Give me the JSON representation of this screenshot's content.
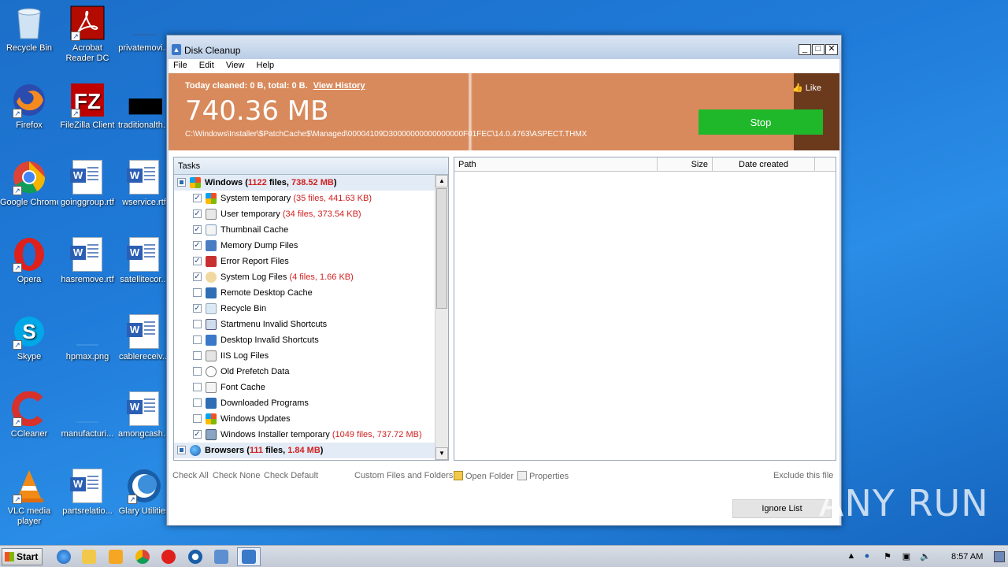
{
  "desktop": {
    "icons": [
      {
        "label": "Recycle Bin"
      },
      {
        "label": "Acrobat Reader DC"
      },
      {
        "label": "privatemovi..."
      },
      {
        "label": "Firefox"
      },
      {
        "label": "FileZilla Client"
      },
      {
        "label": "traditionalth..."
      },
      {
        "label": "Google Chrome"
      },
      {
        "label": "goinggroup.rtf"
      },
      {
        "label": "wservice.rtf"
      },
      {
        "label": "Opera"
      },
      {
        "label": "hasremove.rtf"
      },
      {
        "label": "satellitecor..."
      },
      {
        "label": "Skype"
      },
      {
        "label": "hpmax.png"
      },
      {
        "label": "cablereceiv..."
      },
      {
        "label": "CCleaner"
      },
      {
        "label": "manufacturi..."
      },
      {
        "label": "amongcash..."
      },
      {
        "label": "VLC media player"
      },
      {
        "label": "partsrelatio..."
      },
      {
        "label": "Glary Utilities"
      }
    ]
  },
  "window": {
    "title": "Disk Cleanup",
    "menu": [
      "File",
      "Edit",
      "View",
      "Help"
    ],
    "banner": {
      "summary": "Today cleaned: 0 B, total: 0 B.",
      "view_history": "View History",
      "size": "740.36 MB",
      "path": "C:\\Windows\\Installer\\$PatchCache$\\Managed\\00004109D30000000000000000F01FEC\\14.0.4763\\ASPECT.THMX",
      "like": "Like",
      "stop": "Stop",
      "colors": {
        "background": "#d88a5c",
        "stop": "#1fb82b",
        "dark": "#6b3a1d"
      }
    },
    "tasks": {
      "header": "Tasks",
      "groups": [
        {
          "name": "Windows",
          "open": "(",
          "count": "1122",
          "files": "files,",
          "size": "738.52 MB",
          "close": ")"
        }
      ],
      "items": [
        {
          "name": "System temporary",
          "checked": true,
          "detail_open": "(",
          "count": "35",
          "files": "files,",
          "size": "441.63 KB",
          "detail_close": ")"
        },
        {
          "name": "User temporary",
          "checked": true,
          "detail_open": "(",
          "count": "34",
          "files": "files,",
          "size": "373.54 KB",
          "detail_close": ")"
        },
        {
          "name": "Thumbnail Cache",
          "checked": true
        },
        {
          "name": "Memory Dump Files",
          "checked": true
        },
        {
          "name": "Error Report Files",
          "checked": true
        },
        {
          "name": "System Log Files",
          "checked": true,
          "detail_open": "(",
          "count": "4",
          "files": "files,",
          "size": "1.66 KB",
          "detail_close": ")"
        },
        {
          "name": "Remote Desktop Cache",
          "checked": false
        },
        {
          "name": "Recycle Bin",
          "checked": true
        },
        {
          "name": "Startmenu Invalid Shortcuts",
          "checked": false
        },
        {
          "name": "Desktop Invalid Shortcuts",
          "checked": false
        },
        {
          "name": "IIS Log Files",
          "checked": false
        },
        {
          "name": "Old Prefetch Data",
          "checked": false
        },
        {
          "name": "Font Cache",
          "checked": false
        },
        {
          "name": "Downloaded Programs",
          "checked": false
        },
        {
          "name": "Windows Updates",
          "checked": false
        },
        {
          "name": "Windows Installer temporary",
          "checked": true,
          "detail_open": "(",
          "count": "1049",
          "files": "files,",
          "size": "737.72 MB",
          "detail_close": ")"
        }
      ],
      "group2": {
        "name": "Browsers",
        "open": "(",
        "count": "111",
        "files": "files,",
        "size": "1.84 MB",
        "close": ")"
      }
    },
    "files": {
      "columns": [
        "Path",
        "Size",
        "Date created"
      ]
    },
    "bottom": {
      "check_all": "Check All",
      "check_none": "Check None",
      "check_default": "Check Default",
      "custom": "Custom Files and Folders",
      "open_folder": "Open Folder",
      "properties": "Properties",
      "exclude": "Exclude this file",
      "ignore_list": "Ignore List"
    }
  },
  "watermark": "ANY RUN",
  "taskbar": {
    "start": "Start",
    "clock": "8:57 AM"
  }
}
